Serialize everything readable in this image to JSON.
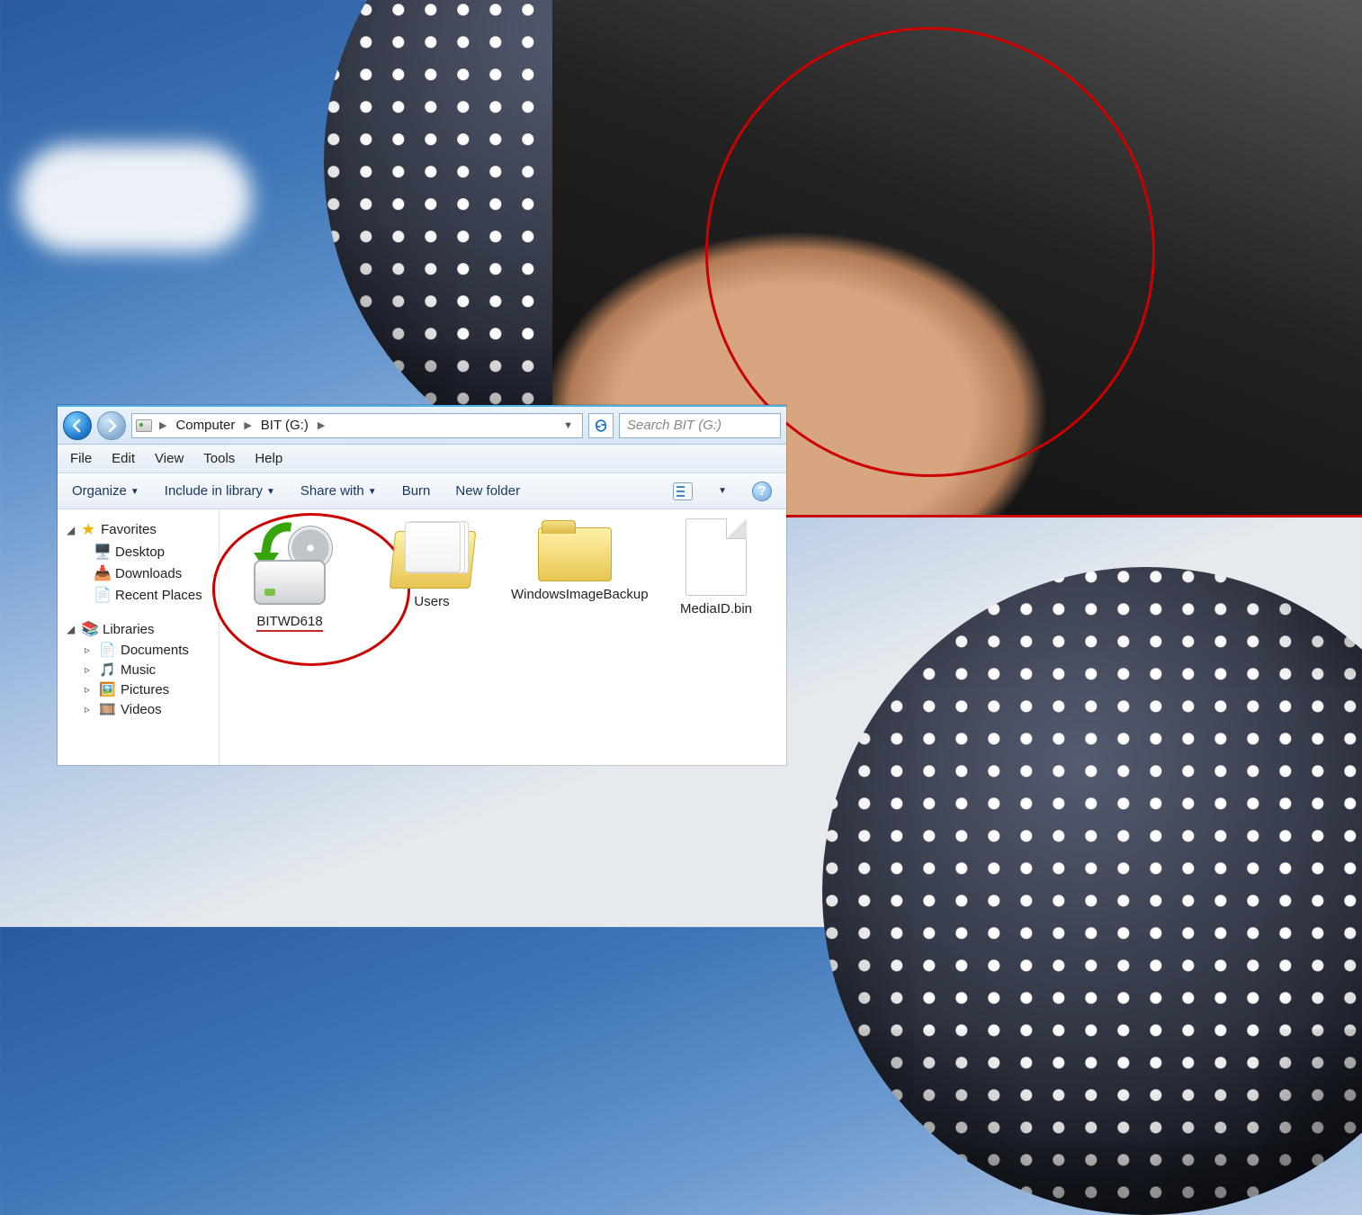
{
  "breadcrumb": {
    "seg1": "Computer",
    "seg2": "BIT (G:)"
  },
  "search": {
    "placeholder": "Search BIT (G:)"
  },
  "menu": {
    "file": "File",
    "edit": "Edit",
    "view": "View",
    "tools": "Tools",
    "help": "Help"
  },
  "toolbar": {
    "organize": "Organize",
    "include": "Include in library",
    "share": "Share with",
    "burn": "Burn",
    "newfolder": "New folder"
  },
  "nav": {
    "favorites": "Favorites",
    "desktop": "Desktop",
    "downloads": "Downloads",
    "recent": "Recent Places",
    "libraries": "Libraries",
    "documents": "Documents",
    "music": "Music",
    "pictures": "Pictures",
    "videos": "Videos"
  },
  "items": {
    "backup": "BITWD618",
    "users": "Users",
    "wib": "WindowsImageBackup",
    "mediaid": "MediaID.bin"
  }
}
